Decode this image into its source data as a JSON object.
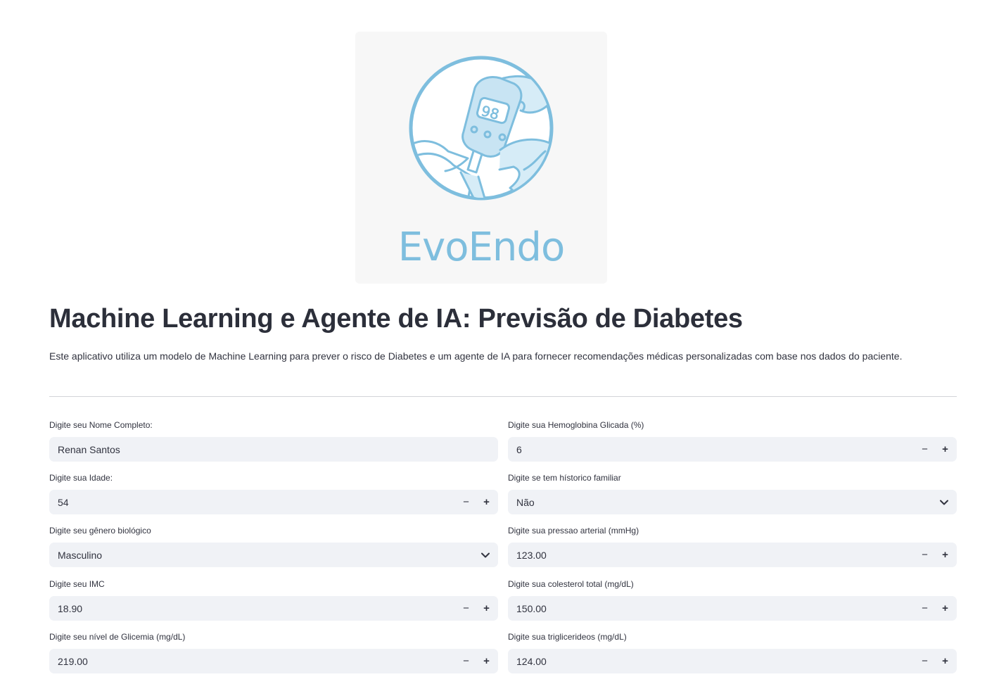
{
  "logo": {
    "brand": "EvoEndo",
    "display_value": "98"
  },
  "header": {
    "title": "Machine Learning e Agente de IA: Previsão de Diabetes",
    "description": "Este aplicativo utiliza um modelo de Machine Learning para prever o risco de Diabetes e um agente de IA para fornecer recomendações médicas personalizadas com base nos dados do paciente."
  },
  "stepper": {
    "minus": "−",
    "plus": "+"
  },
  "form": {
    "nome": {
      "label": "Digite seu Nome Completo:",
      "value": "Renan Santos"
    },
    "idade": {
      "label": "Digite sua Idade:",
      "value": "54"
    },
    "genero": {
      "label": "Digite seu gênero biológico",
      "value": "Masculino"
    },
    "imc": {
      "label": "Digite seu IMC",
      "value": "18.90"
    },
    "glicemia": {
      "label": "Digite seu nível de Glicemia (mg/dL)",
      "value": "219.00"
    },
    "hemoglobina": {
      "label": "Digite sua Hemoglobina Glicada (%)",
      "value": "6"
    },
    "historico": {
      "label": "Digite se tem hístorico familiar",
      "value": "Não"
    },
    "pressao": {
      "label": "Digite sua pressao arterial (mmHg)",
      "value": "123.00"
    },
    "colesterol": {
      "label": "Digite sua colesterol total (mg/dL)",
      "value": "150.00"
    },
    "triglicerideos": {
      "label": "Digite sua triglicerideos (mg/dL)",
      "value": "124.00"
    }
  }
}
